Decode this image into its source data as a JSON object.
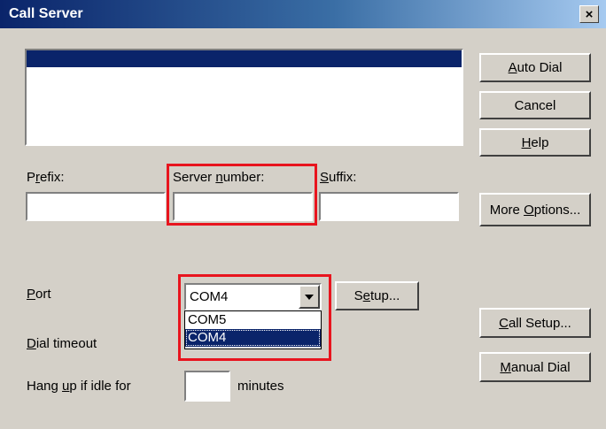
{
  "window": {
    "title": "Call Server",
    "close_glyph": "×"
  },
  "server_list": {
    "items": [
      ""
    ],
    "selected_index": 0
  },
  "fields": {
    "prefix": {
      "label": "Prefix:",
      "mnemonic_index": 1,
      "value": ""
    },
    "server_number": {
      "label": "Server number:",
      "mnemonic_index": 7,
      "value": ""
    },
    "suffix": {
      "label": "Suffix:",
      "mnemonic_index": 0,
      "value": ""
    }
  },
  "port": {
    "label": "Port",
    "mnemonic_index": 0,
    "selected": "COM4",
    "options": [
      "COM5",
      "COM4"
    ],
    "highlighted_option": "COM4",
    "setup_label": "Setup...",
    "setup_mnemonic_index": 1
  },
  "dial_timeout": {
    "label": "Dial timeout",
    "mnemonic_index": 0
  },
  "hang_up": {
    "label": "Hang up if idle for",
    "mnemonic_index": 5,
    "value": "",
    "unit": "minutes"
  },
  "buttons": {
    "auto_dial": {
      "label": "Auto Dial",
      "mnemonic_index": 0
    },
    "cancel": {
      "label": "Cancel"
    },
    "help": {
      "label": "Help",
      "mnemonic_index": 0
    },
    "more_options": {
      "label": "More Options...",
      "mnemonic_index": 5
    },
    "call_setup": {
      "label": "Call Setup...",
      "mnemonic_index": 0
    },
    "manual_dial": {
      "label": "Manual Dial",
      "mnemonic_index": 0
    }
  },
  "colors": {
    "highlight_border": "#e8141e",
    "selection": "#0a246a",
    "face": "#d4d0c8"
  }
}
